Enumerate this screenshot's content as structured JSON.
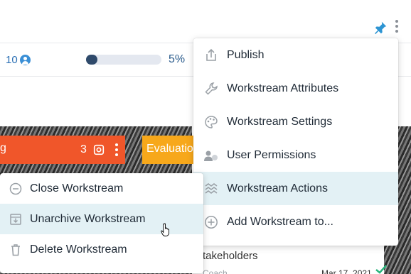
{
  "header": {
    "pin_icon": "pin-icon",
    "more_icon": "vertical-ellipsis-icon",
    "pin_color": "#2e95d3"
  },
  "summary": {
    "member_count": "10",
    "member_icon": "user-circle-icon",
    "progress_percent": 5,
    "progress_label": "5%"
  },
  "cards": {
    "red": {
      "title_fragment": "g",
      "count": "3",
      "color": "#f0562a"
    },
    "yellow": {
      "title": "Evaluatio",
      "color": "#f7a81b"
    }
  },
  "card_menu": {
    "items": [
      {
        "label": "Publish",
        "icon": "upload-icon"
      },
      {
        "label": "Workstream Attributes",
        "icon": "wrench-icon"
      },
      {
        "label": "Workstream Settings",
        "icon": "palette-icon"
      },
      {
        "label": "User Permissions",
        "icon": "user-permissions-icon"
      },
      {
        "label": "Workstream Actions",
        "icon": "waves-icon",
        "highlighted": true
      },
      {
        "label": "Add Workstream to...",
        "icon": "plus-circle-icon"
      }
    ]
  },
  "actions_submenu": {
    "items": [
      {
        "label": "Close Workstream",
        "icon": "minus-circle-icon"
      },
      {
        "label": "Unarchive Workstream",
        "icon": "unarchive-icon",
        "highlighted": true
      },
      {
        "label": "Delete Workstream",
        "icon": "trash-icon"
      }
    ]
  },
  "background_fragments": {
    "stakeholders": "takeholders",
    "coach": "Coach",
    "date": "Mar 17, 2021",
    "check_color": "#2ab57d"
  }
}
